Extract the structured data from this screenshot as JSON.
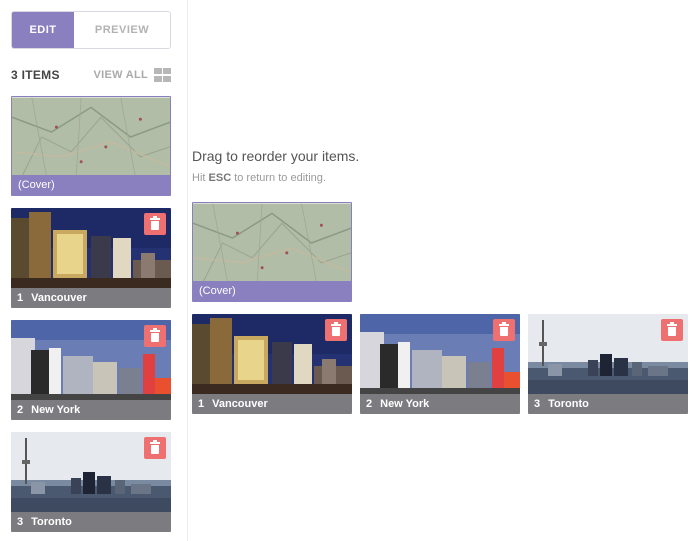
{
  "toggle": {
    "edit_label": "EDIT",
    "preview_label": "PREVIEW"
  },
  "items_header": {
    "count_label": "3 ITEMS",
    "view_all_label": "VIEW ALL"
  },
  "sidebar_cards": [
    {
      "type": "cover",
      "caption": "(Cover)"
    },
    {
      "num": "1",
      "caption": "Vancouver"
    },
    {
      "num": "2",
      "caption": "New York"
    },
    {
      "num": "3",
      "caption": "Toronto"
    }
  ],
  "reorder": {
    "title": "Drag to reorder your items.",
    "hint_prefix": "Hit",
    "hint_key": "ESC",
    "hint_suffix": "to return to editing.",
    "cover_caption": "(Cover)",
    "items": [
      {
        "num": "1",
        "caption": "Vancouver"
      },
      {
        "num": "2",
        "caption": "New York"
      },
      {
        "num": "3",
        "caption": "Toronto"
      }
    ]
  },
  "colors": {
    "accent": "#8a7fbf",
    "delete": "#ef7070",
    "caption_bg": "#7c7c80"
  }
}
